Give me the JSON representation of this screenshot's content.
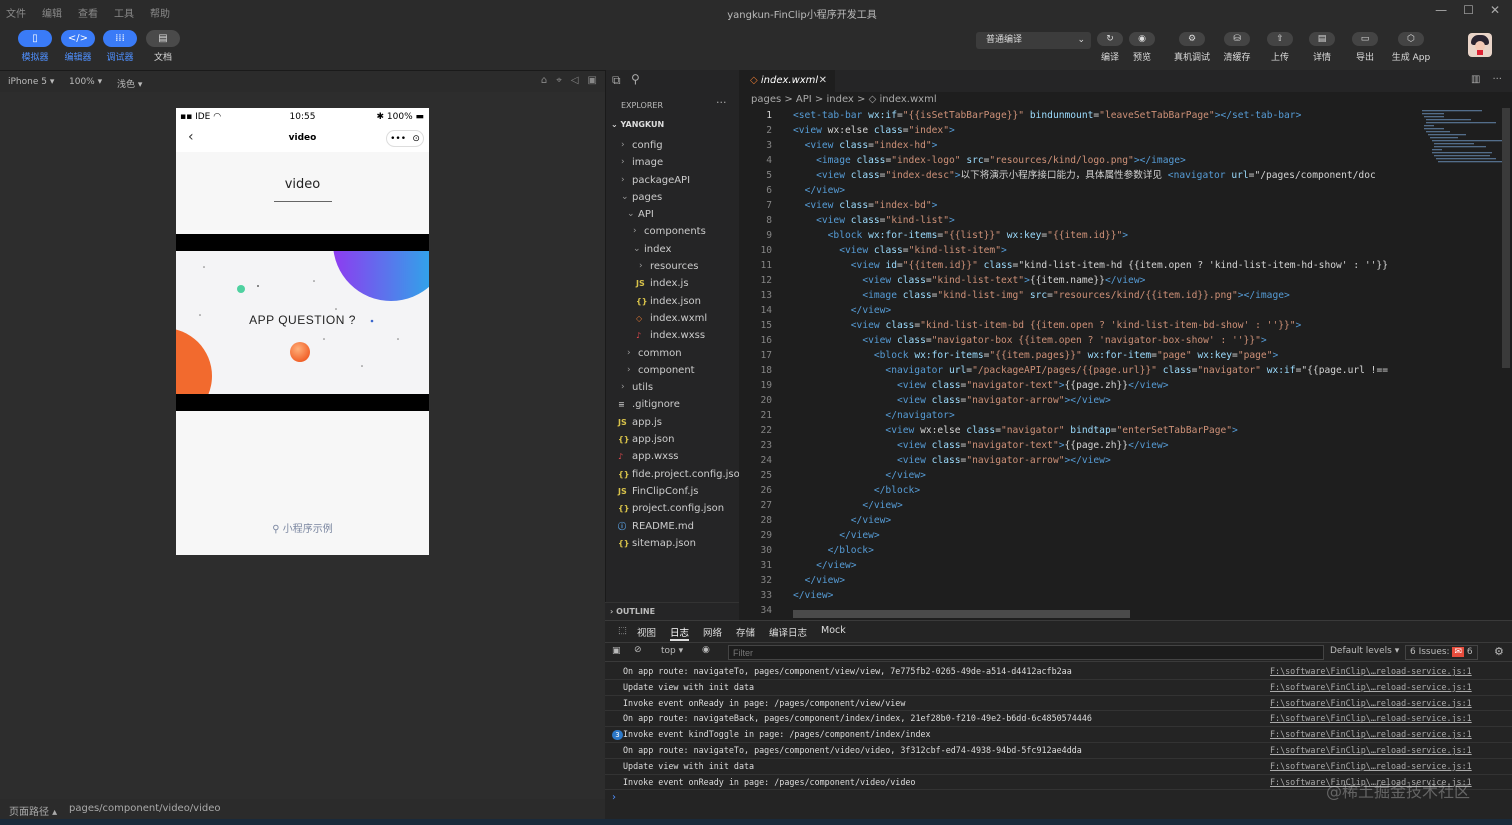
{
  "window": {
    "title": "yangkun-FinClip小程序开发工具",
    "menus": [
      "文件",
      "编辑",
      "查看",
      "工具",
      "帮助"
    ],
    "controls": [
      "—",
      "☐",
      "✕"
    ]
  },
  "toolbar": {
    "left": [
      {
        "label": "模拟器",
        "icon": "▯"
      },
      {
        "label": "编辑器",
        "icon": "</>"
      },
      {
        "label": "调试器",
        "icon": "⁞⁞⁞"
      },
      {
        "label": "文档",
        "icon": "▤"
      }
    ],
    "compile_mode": "普通编译",
    "right": [
      {
        "label": "编译",
        "icon": "↻"
      },
      {
        "label": "预览",
        "icon": "◉"
      },
      {
        "label": "真机调试",
        "icon": "⚙"
      },
      {
        "label": "清缓存",
        "icon": "⛁"
      },
      {
        "label": "上传",
        "icon": "⇧"
      },
      {
        "label": "详情",
        "icon": "▤"
      },
      {
        "label": "导出",
        "icon": "▭"
      },
      {
        "label": "生成 App",
        "icon": "⬡"
      }
    ]
  },
  "simulator": {
    "device": "iPhone 5",
    "zoom": "100%",
    "theme": "浅色",
    "status": {
      "carrier": "IDE",
      "time": "10:55",
      "battery": "100%"
    },
    "nav_title": "video",
    "capsule": [
      "•••",
      "⊙"
    ],
    "video_title": "video",
    "poster_text": "APP QUESTION ?",
    "footer_link": "小程序示例"
  },
  "statusbar": {
    "label": "页面路径",
    "path": "pages/component/video/video"
  },
  "explorer": {
    "header": "EXPLORER",
    "project": "YANGKUN",
    "items": [
      {
        "name": "config",
        "depth": 0,
        "type": "folder",
        "open": false
      },
      {
        "name": "image",
        "depth": 0,
        "type": "folder",
        "open": false
      },
      {
        "name": "packageAPI",
        "depth": 0,
        "type": "folder",
        "open": false
      },
      {
        "name": "pages",
        "depth": 0,
        "type": "folder",
        "open": true
      },
      {
        "name": "API",
        "depth": 1,
        "type": "folder",
        "open": true
      },
      {
        "name": "components",
        "depth": 2,
        "type": "folder",
        "open": false
      },
      {
        "name": "index",
        "depth": 2,
        "type": "folder",
        "open": true
      },
      {
        "name": "resources",
        "depth": 3,
        "type": "folder",
        "open": false
      },
      {
        "name": "index.js",
        "depth": 3,
        "type": "js"
      },
      {
        "name": "index.json",
        "depth": 3,
        "type": "json"
      },
      {
        "name": "index.wxml",
        "depth": 3,
        "type": "wxml"
      },
      {
        "name": "index.wxss",
        "depth": 3,
        "type": "wxss"
      },
      {
        "name": "common",
        "depth": 1,
        "type": "folder",
        "open": false
      },
      {
        "name": "component",
        "depth": 1,
        "type": "folder",
        "open": false
      },
      {
        "name": "utils",
        "depth": 0,
        "type": "folder",
        "open": false
      },
      {
        "name": ".gitignore",
        "depth": 0,
        "type": "txt"
      },
      {
        "name": "app.js",
        "depth": 0,
        "type": "js"
      },
      {
        "name": "app.json",
        "depth": 0,
        "type": "json"
      },
      {
        "name": "app.wxss",
        "depth": 0,
        "type": "wxss"
      },
      {
        "name": "fide.project.config.json",
        "depth": 0,
        "type": "json"
      },
      {
        "name": "FinClipConf.js",
        "depth": 0,
        "type": "js"
      },
      {
        "name": "project.config.json",
        "depth": 0,
        "type": "json"
      },
      {
        "name": "README.md",
        "depth": 0,
        "type": "info"
      },
      {
        "name": "sitemap.json",
        "depth": 0,
        "type": "json"
      }
    ],
    "outline": "OUTLINE"
  },
  "editor": {
    "tab": "index.wxml",
    "breadcrumb": "pages > API > index > ◇ index.wxml",
    "lines": [
      "<set-tab-bar wx:if=\"{{isSetTabBarPage}}\" bindunmount=\"leaveSetTabBarPage\"></set-tab-bar>",
      "<view wx:else class=\"index\">",
      "  <view class=\"index-hd\">",
      "    <image class=\"index-logo\" src=\"resources/kind/logo.png\"></image>",
      "    <view class=\"index-desc\">以下将演示小程序接口能力，具体属性参数详见 <navigator url=\"/pages/component/doc",
      "  </view>",
      "  <view class=\"index-bd\">",
      "    <view class=\"kind-list\">",
      "      <block wx:for-items=\"{{list}}\" wx:key=\"{{item.id}}\">",
      "        <view class=\"kind-list-item\">",
      "          <view id=\"{{item.id}}\" class=\"kind-list-item-hd {{item.open ? 'kind-list-item-hd-show' : ''}}",
      "            <view class=\"kind-list-text\">{{item.name}}</view>",
      "            <image class=\"kind-list-img\" src=\"resources/kind/{{item.id}}.png\"></image>",
      "          </view>",
      "          <view class=\"kind-list-item-bd {{item.open ? 'kind-list-item-bd-show' : ''}}\">",
      "            <view class=\"navigator-box {{item.open ? 'navigator-box-show' : ''}}\">",
      "              <block wx:for-items=\"{{item.pages}}\" wx:for-item=\"page\" wx:key=\"page\">",
      "                <navigator url=\"/packageAPI/pages/{{page.url}}\" class=\"navigator\" wx:if=\"{{page.url !==",
      "                  <view class=\"navigator-text\">{{page.zh}}</view>",
      "                  <view class=\"navigator-arrow\"></view>",
      "                </navigator>",
      "                <view wx:else class=\"navigator\" bindtap=\"enterSetTabBarPage\">",
      "                  <view class=\"navigator-text\">{{page.zh}}</view>",
      "                  <view class=\"navigator-arrow\"></view>",
      "                </view>",
      "              </block>",
      "            </view>",
      "          </view>",
      "        </view>",
      "      </block>",
      "    </view>",
      "  </view>",
      "</view>",
      ""
    ]
  },
  "devtools": {
    "tabs": [
      "视图",
      "日志",
      "网络",
      "存储",
      "编译日志",
      "Mock"
    ],
    "active_tab": "日志",
    "context": "top",
    "filter_placeholder": "Filter",
    "levels": "Default levels",
    "issues": "6 Issues:",
    "issues_count": "6",
    "logs": [
      {
        "msg": "On app route: navigateTo, pages/component/view/view, 7e775fb2-0265-49de-a514-d4412acfb2aa",
        "src": "F:\\software\\FinClip\\…reload-service.js:1",
        "count": ""
      },
      {
        "msg": "Update view with init data",
        "src": "F:\\software\\FinClip\\…reload-service.js:1",
        "count": ""
      },
      {
        "msg": "Invoke event onReady in page: /pages/component/view/view",
        "src": "F:\\software\\FinClip\\…reload-service.js:1",
        "count": ""
      },
      {
        "msg": "On app route: navigateBack, pages/component/index/index, 21ef28b0-f210-49e2-b6dd-6c4850574446",
        "src": "F:\\software\\FinClip\\…reload-service.js:1",
        "count": ""
      },
      {
        "msg": "Invoke event kindToggle in page: /pages/component/index/index",
        "src": "F:\\software\\FinClip\\…reload-service.js:1",
        "count": "3"
      },
      {
        "msg": "On app route: navigateTo, pages/component/video/video, 3f312cbf-ed74-4938-94bd-5fc912ae4dda",
        "src": "F:\\software\\FinClip\\…reload-service.js:1",
        "count": ""
      },
      {
        "msg": "Update view with init data",
        "src": "F:\\software\\FinClip\\…reload-service.js:1",
        "count": ""
      },
      {
        "msg": "Invoke event onReady in page: /pages/component/video/video",
        "src": "F:\\software\\FinClip\\…reload-service.js:1",
        "count": ""
      }
    ]
  },
  "watermark": "@稀土掘金技术社区",
  "colors": {
    "accent": "#3a7bf7",
    "bg": "#1e1e1e",
    "panel": "#252526"
  }
}
